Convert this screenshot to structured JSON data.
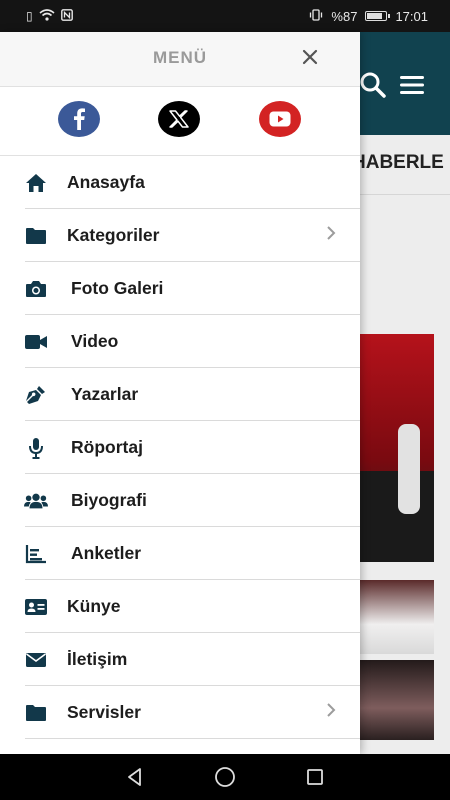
{
  "status_bar": {
    "battery_percent": "%87",
    "time": "17:01",
    "battery_level": 0.87
  },
  "background": {
    "section_heading": "HABERLE"
  },
  "menu": {
    "title": "MENÜ",
    "close_label": "×",
    "social": [
      {
        "name": "facebook",
        "color": "#3b5998"
      },
      {
        "name": "x",
        "color": "#000000"
      },
      {
        "name": "youtube",
        "color": "#d32323"
      }
    ],
    "items": [
      {
        "label": "Anasayfa",
        "icon": "home-icon",
        "has_submenu": false
      },
      {
        "label": "Kategoriler",
        "icon": "folder-icon",
        "has_submenu": true
      },
      {
        "label": "Foto Galeri",
        "icon": "camera-icon",
        "has_submenu": false
      },
      {
        "label": "Video",
        "icon": "video-camera-icon",
        "has_submenu": false
      },
      {
        "label": "Yazarlar",
        "icon": "pen-nib-icon",
        "has_submenu": false
      },
      {
        "label": "Röportaj",
        "icon": "microphone-icon",
        "has_submenu": false
      },
      {
        "label": "Biyografi",
        "icon": "users-icon",
        "has_submenu": false
      },
      {
        "label": "Anketler",
        "icon": "bar-chart-icon",
        "has_submenu": false
      },
      {
        "label": "Künye",
        "icon": "id-card-icon",
        "has_submenu": false
      },
      {
        "label": "İletişim",
        "icon": "envelope-icon",
        "has_submenu": false
      },
      {
        "label": "Servisler",
        "icon": "folder-icon",
        "has_submenu": true
      }
    ]
  },
  "colors": {
    "accent_dark": "#11424f",
    "icon_color": "#12384a"
  }
}
